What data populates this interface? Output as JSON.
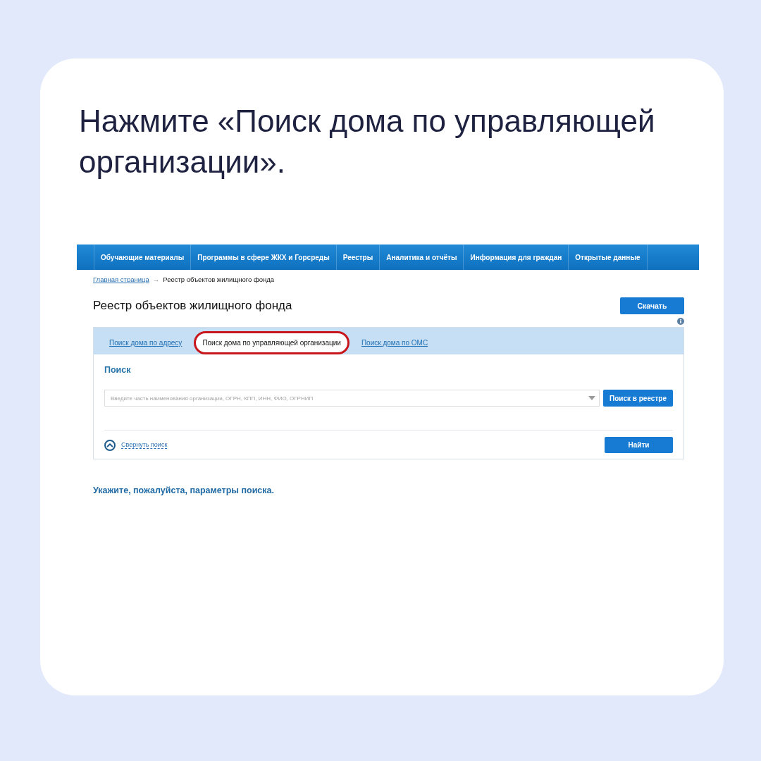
{
  "instruction": "Нажмите «Поиск дома по управляющей организации».",
  "site": {
    "nav": [
      {
        "label": "Обучающие материалы"
      },
      {
        "label": "Программы в сфере ЖКХ и Горсреды"
      },
      {
        "label": "Реестры"
      },
      {
        "label": "Аналитика и отчёты"
      },
      {
        "label": "Информация для граждан"
      },
      {
        "label": "Открытые данные"
      }
    ],
    "breadcrumb": {
      "link": "Главная страница",
      "separator": "→",
      "current": "Реестр объектов жилищного фонда"
    },
    "page_title": "Реестр объектов жилищного фонда",
    "download_button": "Скачать",
    "search_panel": {
      "tabs": [
        {
          "label": "Поиск дома по адресу",
          "selected": false,
          "highlighted": false
        },
        {
          "label": "Поиск дома по управляющей организации",
          "selected": true,
          "highlighted": true
        },
        {
          "label": "Поиск дома по ОМС",
          "selected": false,
          "highlighted": false
        }
      ],
      "heading": "Поиск",
      "search_field": {
        "placeholder": "Введите часть наименования организации, ОГРН, КПП, ИНН, ФИО, ОГРНИП"
      },
      "registry_button": "Поиск в реестре",
      "collapse_link": "Свернуть поиск",
      "find_button": "Найти"
    },
    "hint": "Укажите, пожалуйста, параметры поиска."
  }
}
